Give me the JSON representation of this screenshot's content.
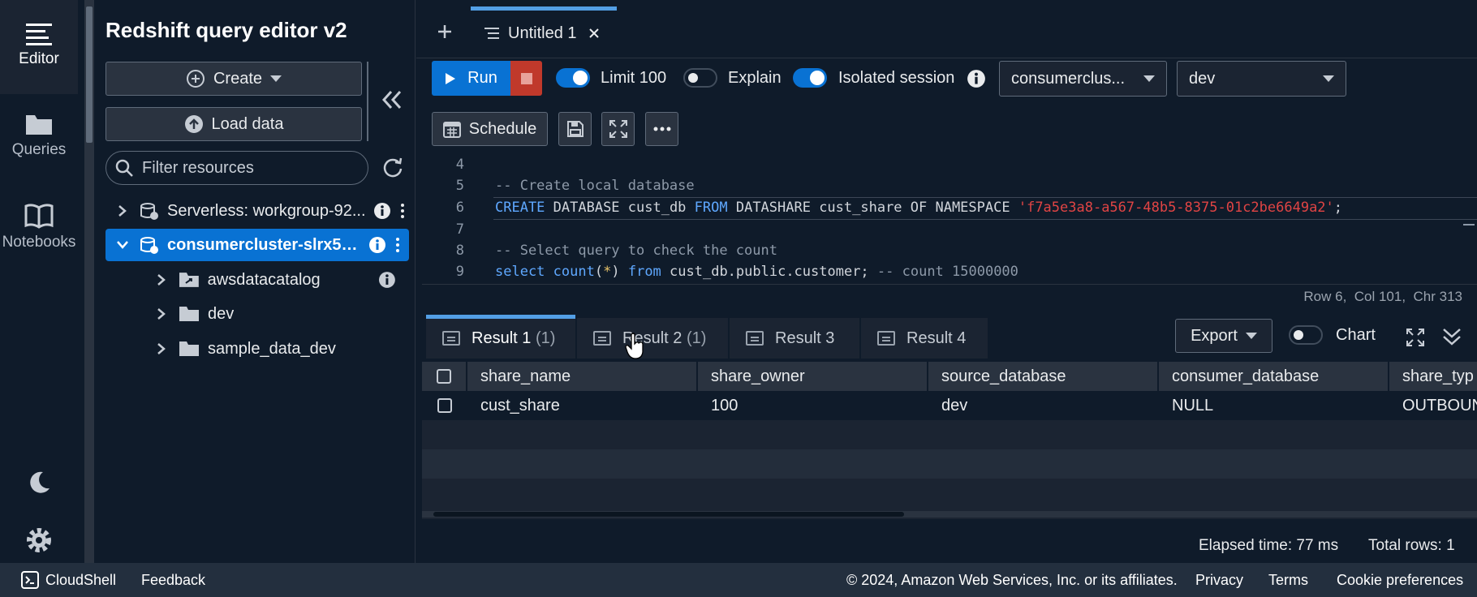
{
  "rail": {
    "items": [
      {
        "label": "Editor",
        "icon": "editor-icon"
      },
      {
        "label": "Queries",
        "icon": "folder-icon"
      },
      {
        "label": "Notebooks",
        "icon": "book-icon"
      }
    ]
  },
  "panel": {
    "title": "Redshift query editor v2",
    "create_label": "Create",
    "load_label": "Load data",
    "filter_placeholder": "Filter resources",
    "tree": [
      {
        "label": "Serverless: workgroup-92...",
        "expanded": false,
        "selected": false
      },
      {
        "label": "consumercluster-slrx5k...",
        "expanded": true,
        "selected": true
      },
      {
        "label": "awsdatacatalog",
        "expanded": false
      },
      {
        "label": "dev",
        "expanded": false
      },
      {
        "label": "sample_data_dev",
        "expanded": false
      }
    ]
  },
  "tabs": {
    "items": [
      {
        "label": "Untitled 1"
      }
    ]
  },
  "toolbar": {
    "run_label": "Run",
    "limit_label": "Limit 100",
    "limit_on": true,
    "explain_label": "Explain",
    "explain_on": false,
    "isolated_label": "Isolated session",
    "isolated_on": true,
    "cluster_value": "consumerclus...",
    "database_value": "dev",
    "schedule_label": "Schedule"
  },
  "editor": {
    "lines": [
      {
        "n": "4",
        "text": ""
      },
      {
        "n": "5",
        "text": "-- Create local database"
      },
      {
        "n": "6",
        "text": "CREATE DATABASE cust_db FROM DATASHARE cust_share OF NAMESPACE 'f7a5e3a8-a567-48b5-8375-01c2be6649a2';"
      },
      {
        "n": "7",
        "text": ""
      },
      {
        "n": "8",
        "text": "-- Select query to check the count"
      },
      {
        "n": "9",
        "text": "select count(*) from cust_db.public.customer; -- count 15000000"
      }
    ],
    "status": "Row 6,  Col 101,  Chr 313"
  },
  "results": {
    "tabs": [
      {
        "label": "Result 1",
        "count": "(1)",
        "active": true
      },
      {
        "label": "Result 2",
        "count": "(1)",
        "active": false
      },
      {
        "label": "Result 3",
        "count": "",
        "active": false
      },
      {
        "label": "Result 4",
        "count": "",
        "active": false
      }
    ],
    "export_label": "Export",
    "chart_label": "Chart",
    "columns": [
      "share_name",
      "share_owner",
      "source_database",
      "consumer_database",
      "share_typ"
    ],
    "rows": [
      [
        "cust_share",
        "100",
        "dev",
        "NULL",
        "OUTBOUN"
      ]
    ],
    "elapsed": "Elapsed time: 77 ms",
    "total_rows": "Total rows: 1"
  },
  "footer": {
    "cloudshell": "CloudShell",
    "feedback": "Feedback",
    "copyright": "© 2024, Amazon Web Services, Inc. or its affiliates.",
    "privacy": "Privacy",
    "terms": "Terms",
    "cookies": "Cookie preferences"
  },
  "colors": {
    "accent": "#0972d3",
    "stop": "#c0392b",
    "string": "#e04444",
    "keyword": "#5fa8ff"
  }
}
